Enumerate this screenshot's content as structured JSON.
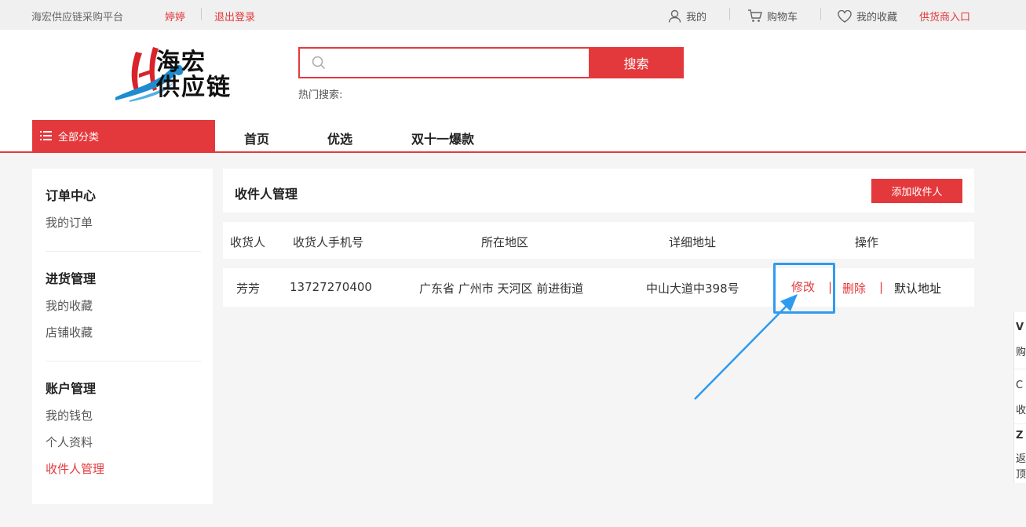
{
  "topbar": {
    "site_name": "海宏供应链采购平台",
    "username": "婷婷",
    "logout": "退出登录",
    "my": "我的",
    "cart": "购物车",
    "favorites": "我的收藏",
    "supplier_entry": "供货商入口"
  },
  "header": {
    "logo_line1": "海宏",
    "logo_line2": "供应链",
    "search_value": "",
    "search_button": "搜索",
    "hot_search_label": "热门搜索:"
  },
  "nav": {
    "all_categories": "全部分类",
    "items": [
      "首页",
      "优选",
      "双十一爆款"
    ]
  },
  "sidebar": {
    "sections": [
      {
        "title": "订单中心",
        "items": [
          "我的订单"
        ]
      },
      {
        "title": "进货管理",
        "items": [
          "我的收藏",
          "店铺收藏"
        ]
      },
      {
        "title": "账户管理",
        "items": [
          "我的钱包",
          "个人资料",
          "收件人管理"
        ]
      }
    ],
    "active_item": "收件人管理"
  },
  "main": {
    "title": "收件人管理",
    "add_button": "添加收件人",
    "columns": [
      "收货人",
      "收货人手机号",
      "所在地区",
      "详细地址",
      "操作"
    ],
    "rows": [
      {
        "name": "芳芳",
        "phone": "13727270400",
        "region": "广东省 广州市 天河区 前进街道",
        "address": "中山大道中398号",
        "actions": {
          "edit": "修改",
          "delete": "删除",
          "set_default": "默认地址",
          "separator": "|"
        }
      }
    ]
  },
  "float_bar": {
    "items": [
      "V",
      "购",
      "C",
      "收",
      "Z",
      "返",
      "顶"
    ]
  },
  "colors": {
    "accent": "#e4393c",
    "highlight": "#2f9bf0"
  }
}
